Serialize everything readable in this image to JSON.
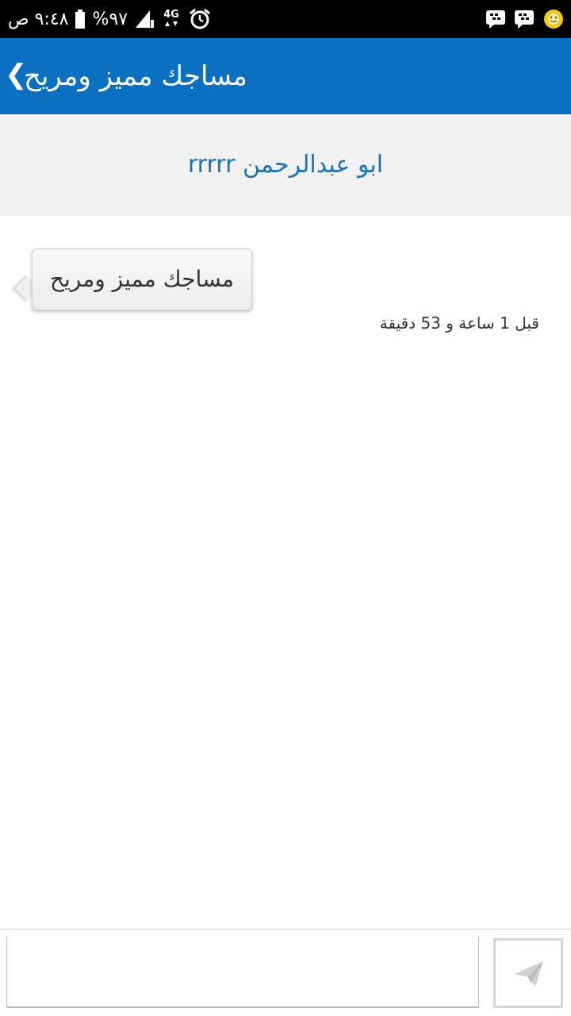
{
  "status_bar": {
    "time": "٩:٤٨ ص",
    "battery": "%٩٧",
    "network": "4G"
  },
  "header": {
    "title": "مساجك مميز ومريح",
    "back_glyph": "❮"
  },
  "author": {
    "name": "ابو عبدالرحمن rrrrr"
  },
  "message": {
    "text": "مساجك مميز ومريح",
    "time": "قبل 1 ساعة و 53 دقيقة"
  },
  "compose": {
    "placeholder": "",
    "send_icon": "paper-plane-icon"
  },
  "colors": {
    "app_bar": "#0b70bf",
    "author_name": "#1a72b8",
    "author_band": "#f2f2f2",
    "status_bar": "#000000"
  }
}
